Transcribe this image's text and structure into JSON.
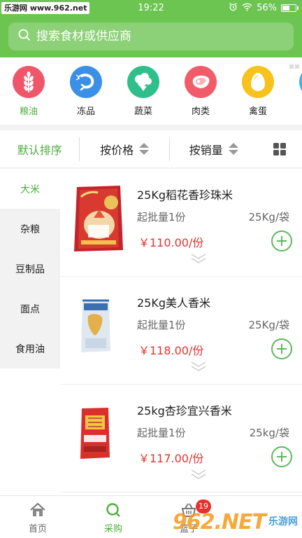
{
  "status_bar": {
    "watermark": "乐游网 www.962.net",
    "time": "19:22",
    "battery": "56%",
    "battery_level": 0.56
  },
  "search": {
    "placeholder": "搜索食材或供应商"
  },
  "categories": [
    {
      "label": "粮油",
      "icon": "wheat-icon",
      "color": "#f0566a"
    },
    {
      "label": "冻品",
      "icon": "shrimp-icon",
      "color": "#3a8fe6"
    },
    {
      "label": "蔬菜",
      "icon": "cauliflower-icon",
      "color": "#2fbf8a"
    },
    {
      "label": "肉类",
      "icon": "meat-icon",
      "color": "#f25c6a"
    },
    {
      "label": "禽蛋",
      "icon": "egg-icon",
      "color": "#f7c21b"
    }
  ],
  "sort": {
    "default": "默认排序",
    "price": "按价格",
    "sales": "按销量"
  },
  "sidebar": [
    "大米",
    "杂粮",
    "豆制品",
    "面点",
    "食用油"
  ],
  "products": [
    {
      "name": "25Kg稻花香珍珠米",
      "min": "起批量1份",
      "unit": "25Kg/袋",
      "price": "￥110.00/份"
    },
    {
      "name": "25Kg美人香米",
      "min": "起批量1份",
      "unit": "25Kg/袋",
      "price": "￥118.00/份"
    },
    {
      "name": "25kg杏珍宜兴香米",
      "min": "起批量1份",
      "unit": "25kg/袋",
      "price": "￥117.00/份"
    }
  ],
  "bottom_nav": {
    "home": "首页",
    "purchase": "采购",
    "basket": "篮子",
    "basket_badge": "19"
  },
  "watermark2": {
    "number": "962.NET",
    "text": "乐游网"
  },
  "colors": {
    "brand": "#6cc551",
    "accent": "#4cae3d",
    "price": "#e5312c"
  }
}
